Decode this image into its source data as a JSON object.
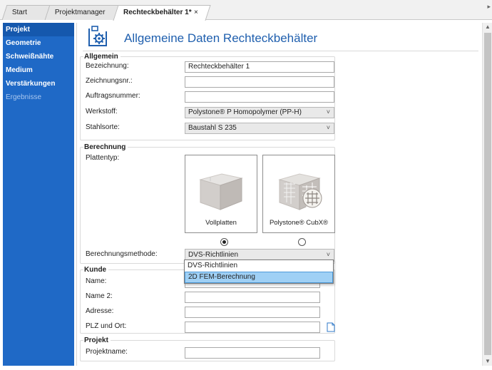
{
  "tabs": [
    {
      "label": "Start"
    },
    {
      "label": "Projektmanager"
    },
    {
      "label": "Rechteckbehälter 1*",
      "close": "×"
    }
  ],
  "tab_end_marker": "▸",
  "sidebar": {
    "items": [
      {
        "label": "Projekt"
      },
      {
        "label": "Geometrie"
      },
      {
        "label": "Schweißnähte"
      },
      {
        "label": "Medium"
      },
      {
        "label": "Verstärkungen"
      },
      {
        "label": "Ergebnisse"
      }
    ]
  },
  "header": {
    "title": "Allgemeine Daten Rechteckbehälter",
    "icon": "container-gear-icon"
  },
  "allgemein": {
    "legend": "Allgemein",
    "bezeichnung_label": "Bezeichnung:",
    "bezeichnung_value": "Rechteckbehälter 1",
    "zeichnungsnr_label": "Zeichnungsnr.:",
    "zeichnungsnr_value": "",
    "auftragsnummer_label": "Auftragsnummer:",
    "auftragsnummer_value": "",
    "werkstoff_label": "Werkstoff:",
    "werkstoff_value": "Polystone® P Homopolymer (PP-H)",
    "stahlsorte_label": "Stahlsorte:",
    "stahlsorte_value": "Baustahl S 235"
  },
  "berechnung": {
    "legend": "Berechnung",
    "plattentyp_label": "Plattentyp:",
    "option1": "Vollplatten",
    "option2": "Polystone® CubX®",
    "methode_label": "Berechnungsmethode:",
    "methode_value": "DVS-Richtlinien",
    "methode_options": [
      "DVS-Richtlinien",
      "2D FEM-Berechnung"
    ]
  },
  "kunde": {
    "legend": "Kunde",
    "name_label": "Name:",
    "name2_label": "Name 2:",
    "adresse_label": "Adresse:",
    "plz_label": "PLZ und Ort:"
  },
  "projekt": {
    "legend": "Projekt",
    "projektname_label": "Projektname:"
  },
  "chevron": "˅",
  "colors": {
    "sidebar": "#1f69c6",
    "title": "#1f5fae",
    "dropdown_highlight": "#9fd0f5"
  }
}
